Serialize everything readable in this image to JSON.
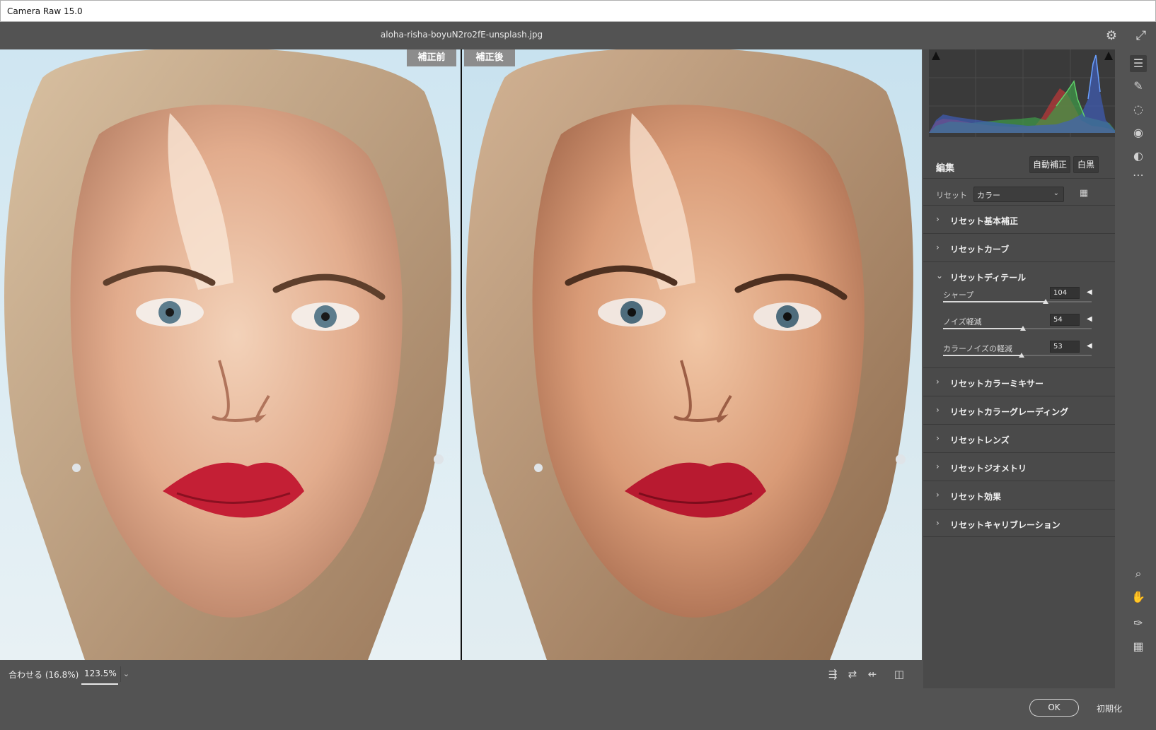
{
  "window": {
    "title": "Camera Raw 15.0"
  },
  "toolbar": {
    "filename": "aloha-risha-boyuN2ro2fE-unsplash.jpg",
    "settings_icon": "gear-icon",
    "fullscreen_icon": "expand-icon"
  },
  "preview": {
    "before_label": "補正前",
    "after_label": "補正後"
  },
  "statusbar": {
    "fit_label": "合わせる (16.8%)",
    "zoom_value": "123.5%"
  },
  "edit": {
    "title": "編集",
    "auto_label": "自動補正",
    "bw_label": "白黒",
    "profile_label": "リセット",
    "profile_value": "カラー",
    "sections": [
      {
        "label": "リセット基本補正",
        "expanded": false
      },
      {
        "label": "リセットカーブ",
        "expanded": false
      },
      {
        "label": "リセットディテール",
        "expanded": true
      },
      {
        "label": "リセットカラーミキサー",
        "expanded": false
      },
      {
        "label": "リセットカラーグレーディング",
        "expanded": false
      },
      {
        "label": "リセットレンズ",
        "expanded": false
      },
      {
        "label": "リセットジオメトリ",
        "expanded": false
      },
      {
        "label": "リセット効果",
        "expanded": false
      },
      {
        "label": "リセットキャリブレーション",
        "expanded": false
      }
    ],
    "detail_sliders": [
      {
        "name": "シャープ",
        "value": "104",
        "fraction": 0.69
      },
      {
        "name": "ノイズ軽減",
        "value": "54",
        "fraction": 0.54
      },
      {
        "name": "カラーノイズの軽減",
        "value": "53",
        "fraction": 0.53
      }
    ]
  },
  "footer": {
    "ok_label": "OK",
    "reset_label": "初期化"
  }
}
